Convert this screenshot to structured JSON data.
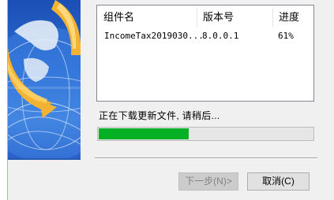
{
  "component_list": {
    "columns": [
      "组件名",
      "版本号",
      "进度"
    ],
    "rows": [
      {
        "name": "IncomeTax2019030...",
        "version": "8.0.0.1",
        "progress": "61%"
      }
    ]
  },
  "status": {
    "message": "正在下载更新文件, 请稍后..."
  },
  "progress": {
    "fraction": 0.42
  },
  "buttons": {
    "next": "下一步(N)>",
    "cancel": "取消(C)"
  },
  "icons": {
    "banner": "globe-arrows-icon"
  },
  "colors": {
    "progress_fill": "#06b025",
    "banner_blue": "#2c6fd6",
    "arrow_gold": "#f2b233"
  }
}
